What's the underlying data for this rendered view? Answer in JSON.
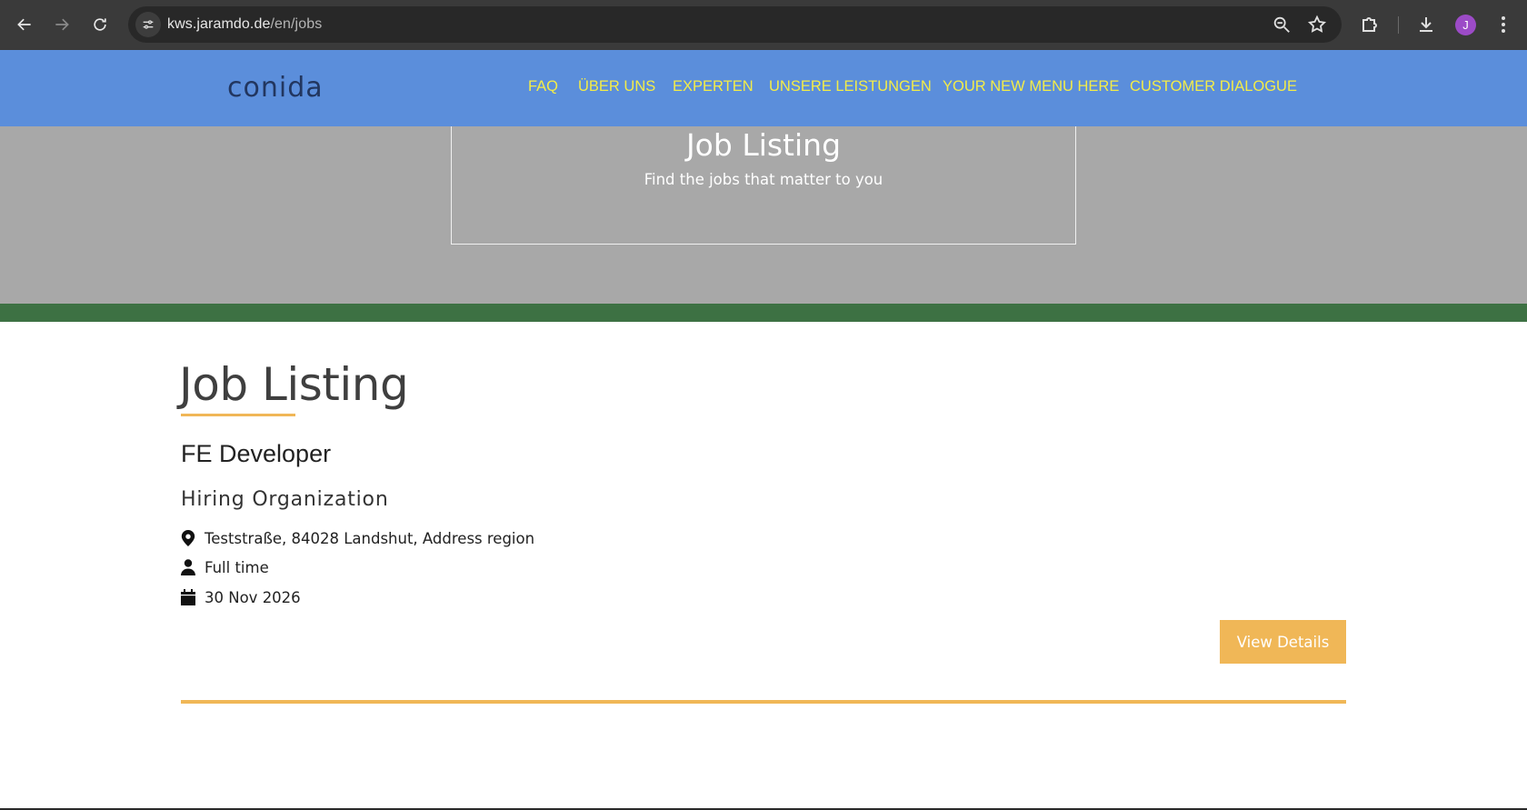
{
  "browser": {
    "url_host": "kws.jaramdo.de",
    "url_path": "/en/jobs",
    "profile_initial": "J",
    "icons": [
      "back-icon",
      "forward-icon",
      "reload-icon",
      "site-info-icon",
      "zoom-icon",
      "bookmark-star-icon",
      "extensions-icon",
      "download-icon",
      "more-menu-icon"
    ]
  },
  "header": {
    "logo": "conida",
    "menu": [
      "FAQ",
      "ÜBER UNS",
      "EXPERTEN",
      "UNSERE LEISTUNGEN",
      "YOUR NEW MENU HERE",
      "CUSTOMER DIALOGUE"
    ]
  },
  "hero": {
    "title": "Job Listing",
    "subtitle": "Find the jobs that matter to you"
  },
  "main": {
    "title": "Job Listing",
    "job": {
      "title": "FE Developer",
      "organization": "Hiring Organization",
      "location": "Teststraße, 84028 Landshut, Address region",
      "employment_type": "Full time",
      "date": "30 Nov 2026",
      "button": "View Details"
    }
  },
  "colors": {
    "header_bg": "#5b8edb",
    "menu_text": "#f3ec48",
    "hero_bg": "#a8a8a8",
    "band": "#3d7143",
    "accent": "#f0b757"
  }
}
